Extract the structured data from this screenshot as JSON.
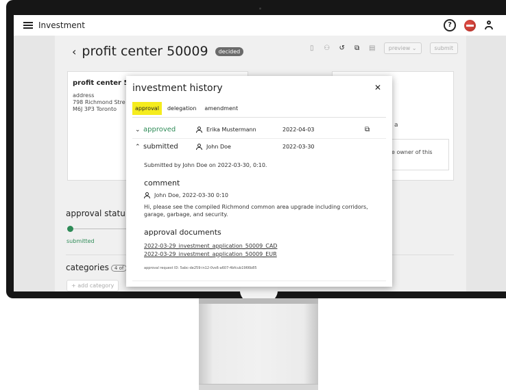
{
  "app": {
    "title": "Investment"
  },
  "page": {
    "title": "profit center 50009",
    "status": "decided",
    "toolbar": {
      "preview_label": "preview ⌄",
      "submit_label": "submit"
    }
  },
  "left_card": {
    "title": "profit center 50",
    "address_label": "address",
    "street": "798 Richmond Stre",
    "city": "M6J 3P3 Toronto"
  },
  "right_card": {
    "fragment": "a",
    "note": "e owner of this"
  },
  "approval_section": {
    "title": "approval statu",
    "status": "submitted"
  },
  "categories_section": {
    "title": "categories",
    "count": "4 of",
    "add_label": "+ add category"
  },
  "dialog": {
    "title": "investment history",
    "tabs": [
      {
        "label": "approval",
        "active": true
      },
      {
        "label": "delegation",
        "active": false
      },
      {
        "label": "amendment",
        "active": false
      }
    ],
    "rows": [
      {
        "chevron": "⌄",
        "status": "approved",
        "user": "Erika Mustermann",
        "date": "2022-04-03"
      },
      {
        "chevron": "⌃",
        "status": "submitted",
        "user": "John Doe",
        "date": "2022-03-30"
      }
    ],
    "submitted_by": "Submitted by John Doe on 2022-03-30, 0:10.",
    "comment_heading": "comment",
    "comment_meta": "John Doe, 2022-03-30 0:10",
    "comment_line1": "Hi, please see the compiled Richmond common area upgrade including corridors,",
    "comment_line2": "garage, garbage, and security.",
    "documents_heading": "approval documents",
    "documents": [
      "2022-03-29_investment_application_50009_CAD",
      "2022-03-29_investment_application_50009_EUR"
    ],
    "request_id": "approval request ID: 5abc-de259-in12-0vs6-a607-4bfcub1966b85"
  },
  "colors": {
    "approved": "#2e8b57",
    "active_tab": "#f5ec1e"
  },
  "icons": [
    "menu-icon",
    "help-icon",
    "flag-avatar",
    "user-icon",
    "back-icon",
    "delete-icon",
    "people-icon",
    "history-icon",
    "copy-icon",
    "document-icon",
    "close-icon",
    "external-link-icon"
  ]
}
